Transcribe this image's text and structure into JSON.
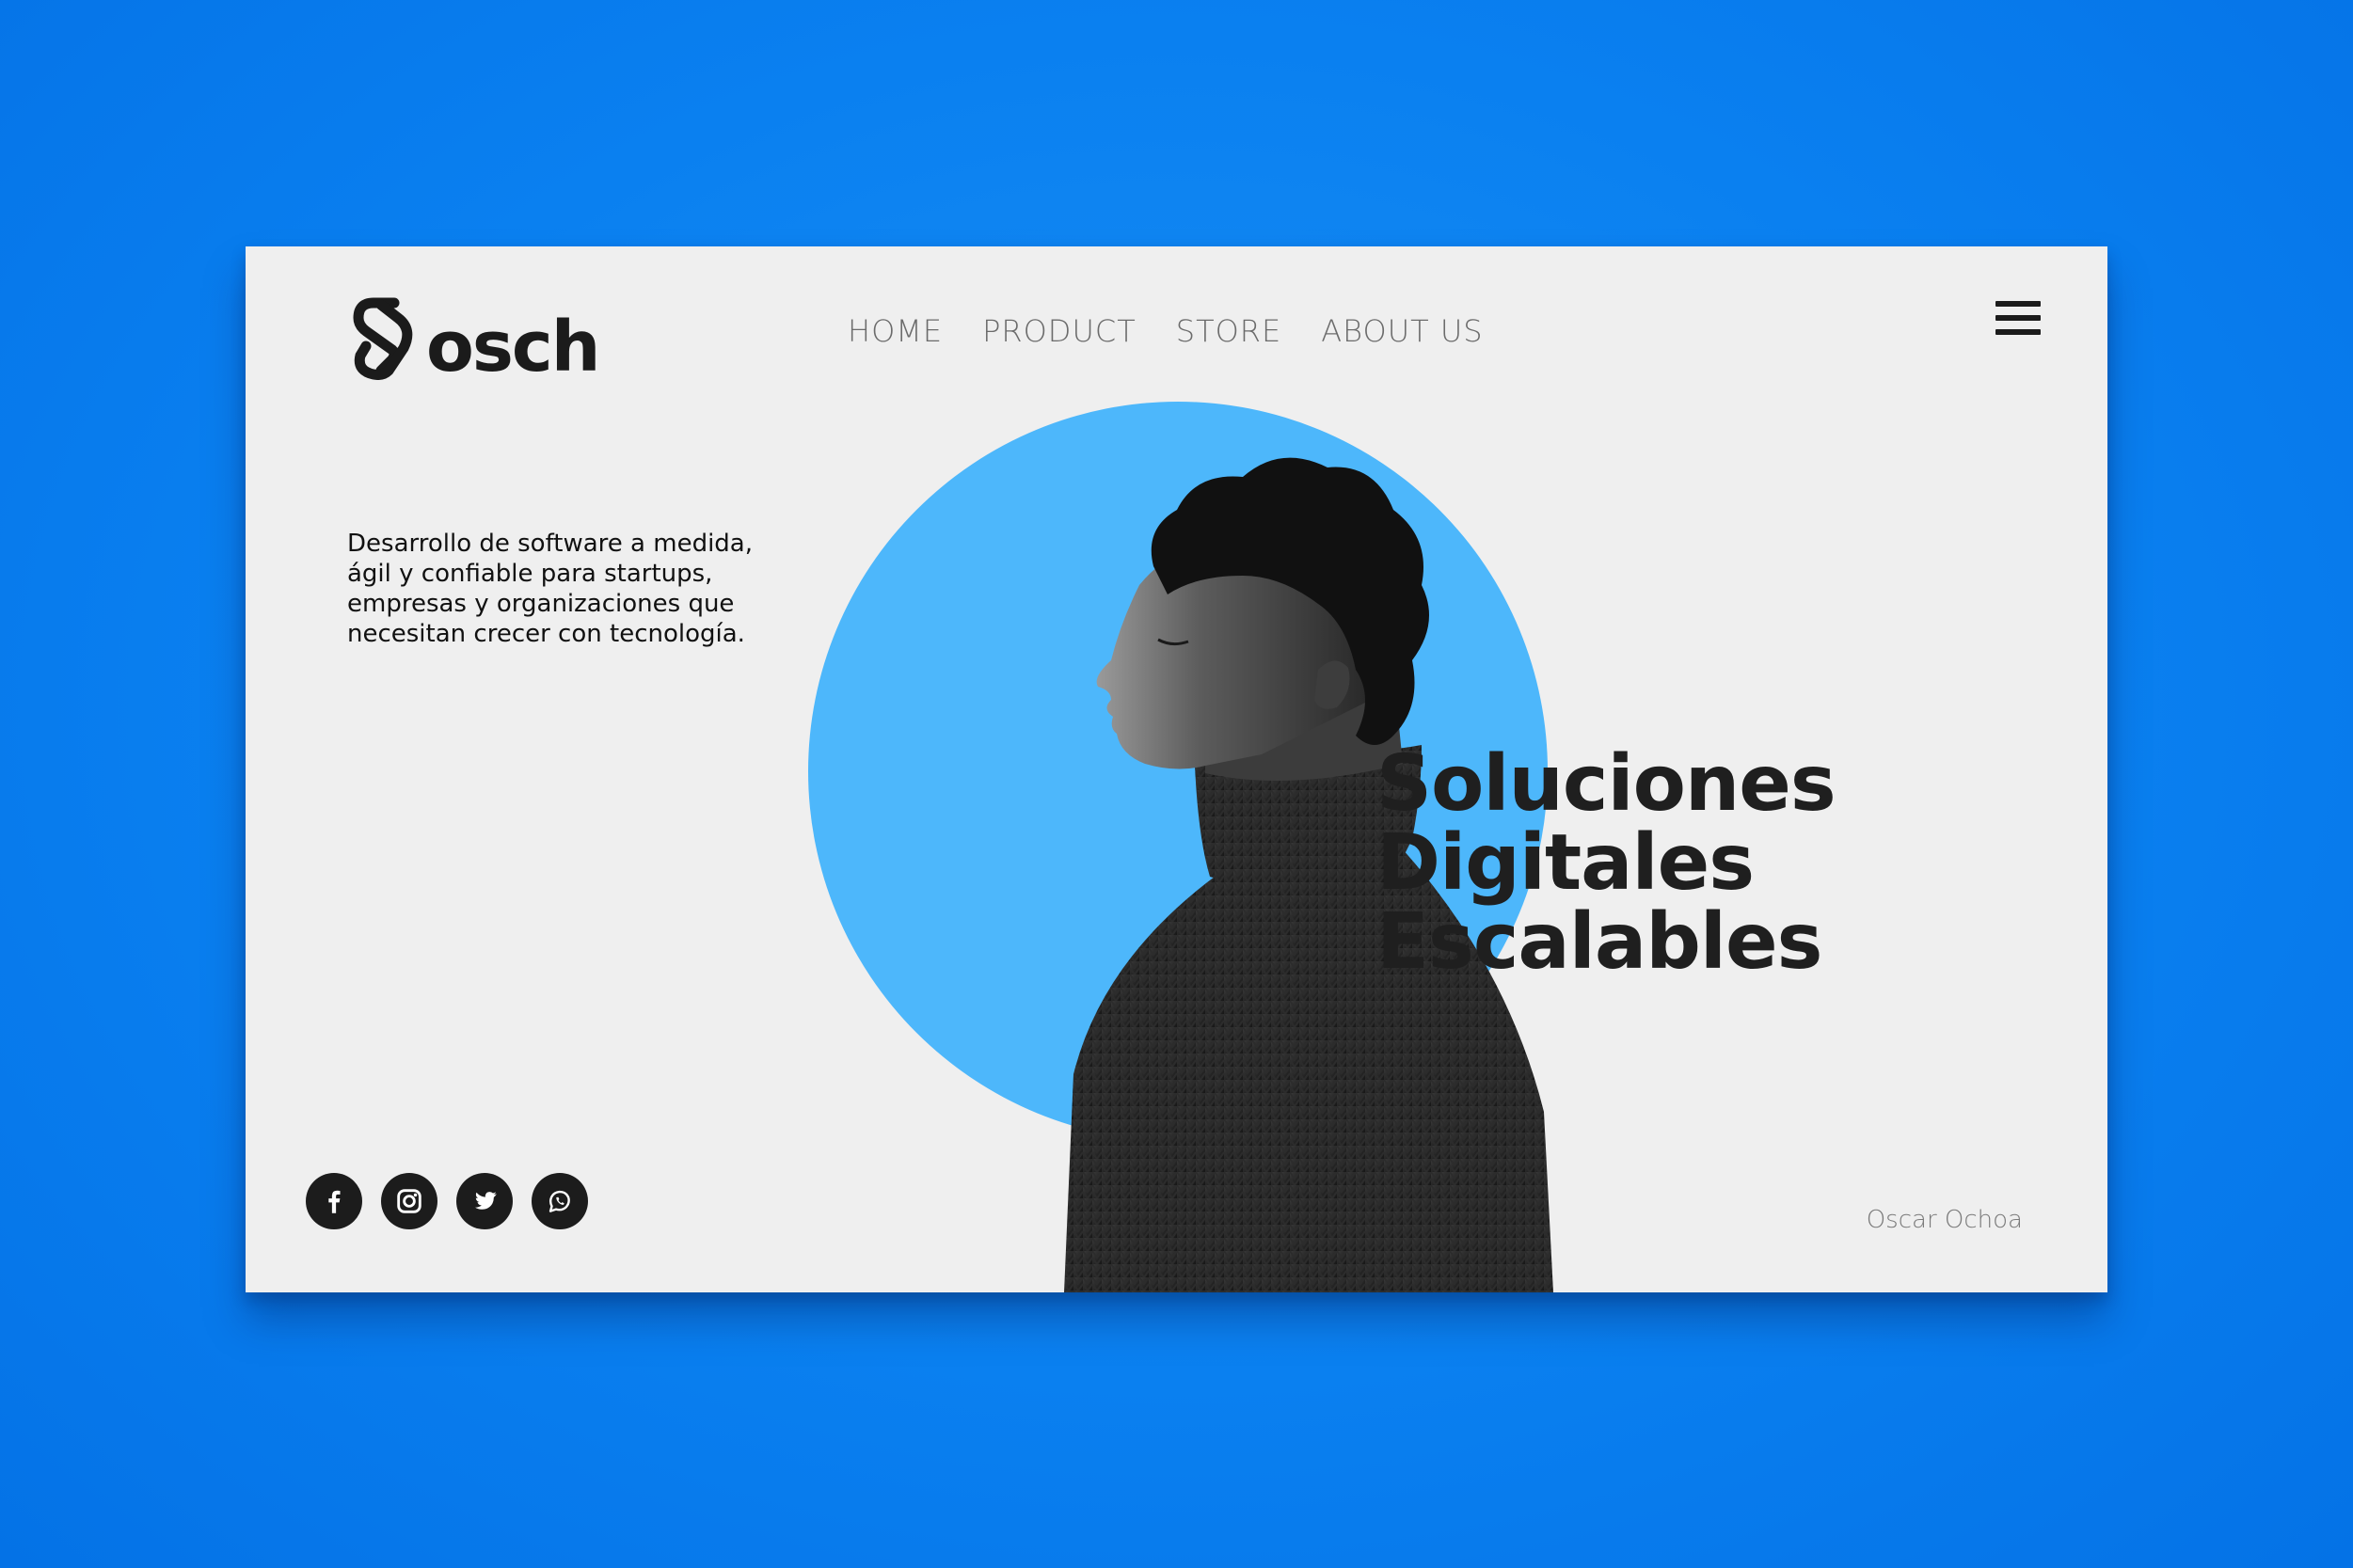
{
  "brand": {
    "logo_text": "Osch",
    "icon": "osch-logo"
  },
  "nav": {
    "items": [
      {
        "label": "HOME"
      },
      {
        "label": "PRODUCT"
      },
      {
        "label": "STORE"
      },
      {
        "label": "ABOUT US"
      }
    ],
    "menu_icon": "hamburger-menu-icon"
  },
  "hero": {
    "tagline": "Desarrollo de software a medida, ágil y confiable para startups, empresas y organizaciones que necesitan crecer con tecnología.",
    "headline": [
      "Soluciones",
      "Digitales",
      "Escalables"
    ],
    "image": "portrait-photo"
  },
  "socials": [
    {
      "name": "facebook",
      "icon": "facebook-icon"
    },
    {
      "name": "instagram",
      "icon": "instagram-icon"
    },
    {
      "name": "twitter",
      "icon": "twitter-icon"
    },
    {
      "name": "whatsapp",
      "icon": "whatsapp-icon"
    }
  ],
  "footer": {
    "author": "Oscar Ochoa"
  },
  "colors": {
    "background": "#0a80f0",
    "card": "#efefef",
    "accent_circle": "#4db7fb",
    "text_dark": "#1f1f1f",
    "nav_text": "#6b6b6b"
  }
}
